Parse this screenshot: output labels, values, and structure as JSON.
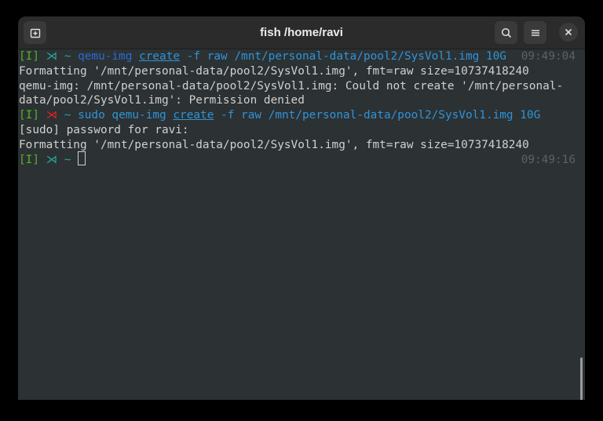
{
  "window": {
    "title": "fish /home/ravi"
  },
  "terminal": {
    "mode": "[I]",
    "prompt_glyph": "⋊",
    "tilde": "~",
    "line1": {
      "cmd": "qemu-img",
      "sub": "create",
      "args": "-f raw /mnt/personal-data/pool2/SysVol1.img 10G",
      "time": "09:49:04"
    },
    "line2": "Formatting '/mnt/personal-data/pool2/SysVol1.img', fmt=raw size=10737418240",
    "line3": "qemu-img: /mnt/personal-data/pool2/SysVol1.img: Could not create '/mnt/personal-",
    "line4": "data/pool2/SysVol1.img': Permission denied",
    "line5": {
      "sudo": "sudo",
      "cmd": "qemu-img",
      "sub": "create",
      "args": "-f raw /mnt/personal-data/pool2/SysVol1.img 10G"
    },
    "line6": "[sudo] password for ravi:",
    "line7": "Formatting '/mnt/personal-data/pool2/SysVol1.img', fmt=raw size=10737418240",
    "line8": {
      "time": "09:49:16"
    }
  },
  "colors": {
    "mode": "#55b325",
    "prompt_ok": "#26a69a",
    "prompt_err": "#e0222a",
    "command": "#2d6ad5",
    "argument": "#2f94d8"
  }
}
